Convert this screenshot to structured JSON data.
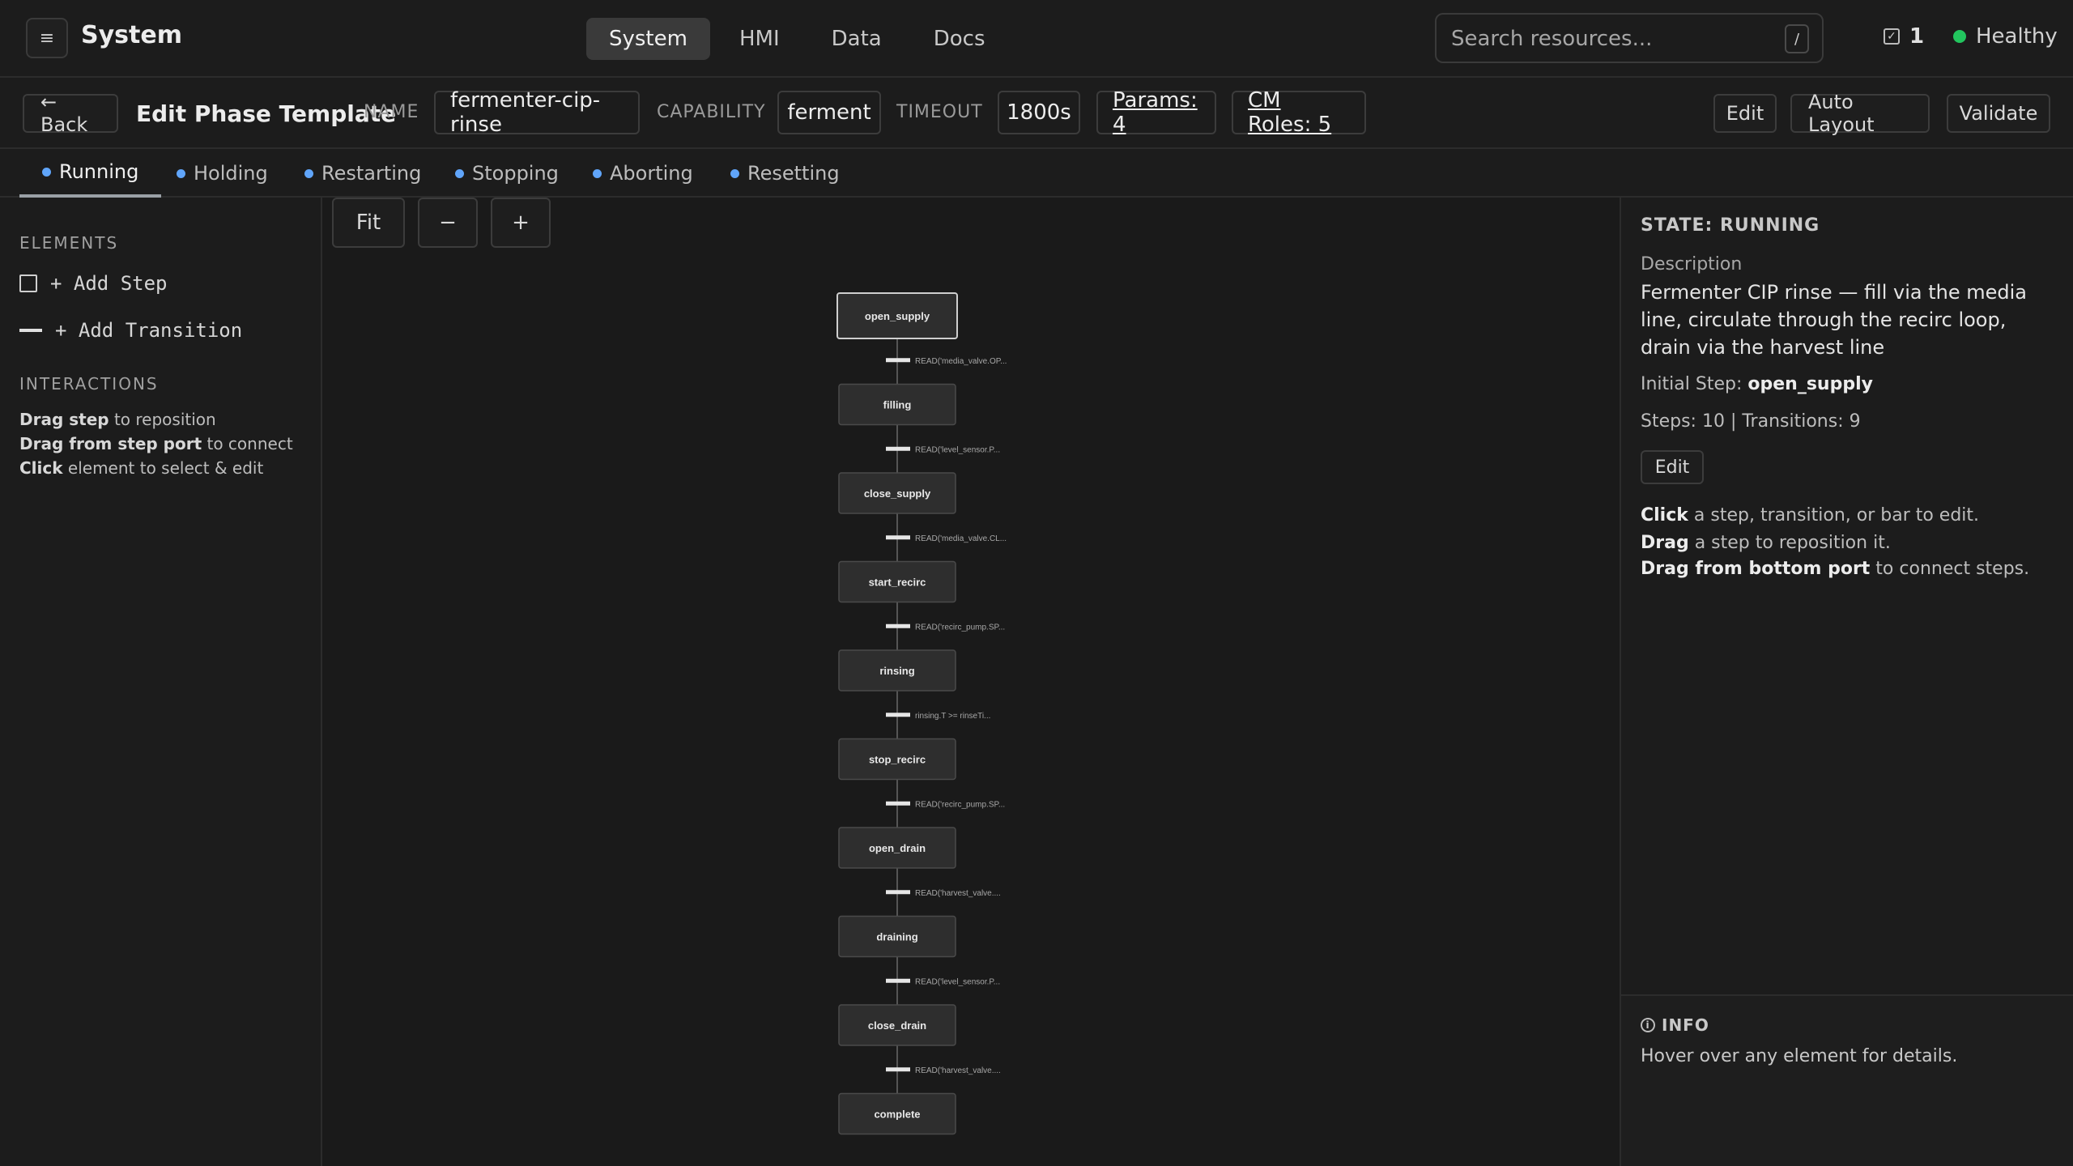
{
  "app": {
    "menu_glyph": "≡",
    "title": "System"
  },
  "nav": [
    {
      "label": "System",
      "active": true
    },
    {
      "label": "HMI",
      "active": false
    },
    {
      "label": "Data",
      "active": false
    },
    {
      "label": "Docs",
      "active": false
    }
  ],
  "search": {
    "placeholder": "Search resources...",
    "shortcut": "/"
  },
  "status": {
    "task_count": "1",
    "health": "Healthy",
    "health_color": "#22c55e"
  },
  "editbar": {
    "back": "← Back",
    "title": "Edit Phase Template",
    "name_label": "NAME",
    "name_value": "fermenter-cip-rinse",
    "capability_label": "CAPABILITY",
    "capability_value": "ferment",
    "timeout_label": "TIMEOUT",
    "timeout_value": "1800s",
    "params": "Params: 4",
    "cm_roles": "CM Roles: 5",
    "edit": "Edit",
    "auto_layout": "Auto Layout",
    "validate": "Validate"
  },
  "tabs": [
    {
      "label": "Running",
      "active": true
    },
    {
      "label": "Holding",
      "active": false
    },
    {
      "label": "Restarting",
      "active": false
    },
    {
      "label": "Stopping",
      "active": false
    },
    {
      "label": "Aborting",
      "active": false
    },
    {
      "label": "Resetting",
      "active": false
    }
  ],
  "left": {
    "elements_heading": "ELEMENTS",
    "add_step": "+ Add Step",
    "add_transition": "+ Add Transition",
    "interactions_heading": "INTERACTIONS",
    "help": [
      {
        "bold": "Drag step",
        "rest": " to reposition"
      },
      {
        "bold": "Drag from step port",
        "rest": " to connect"
      },
      {
        "bold": "Click",
        "rest": " element to select & edit"
      }
    ]
  },
  "canvas": {
    "fit": "Fit",
    "zoom_out": "−",
    "zoom_in": "+",
    "steps": [
      "open_supply",
      "filling",
      "close_supply",
      "start_recirc",
      "rinsing",
      "stop_recirc",
      "open_drain",
      "draining",
      "close_drain",
      "complete"
    ],
    "transitions": [
      "READ('media_valve.OP...",
      "READ('level_sensor.P...",
      "READ('media_valve.CL...",
      "READ('recirc_pump.SP...",
      "rinsing.T >= rinseTi...",
      "READ('recirc_pump.SP...",
      "READ('harvest_valve....",
      "READ('level_sensor.P...",
      "READ('harvest_valve...."
    ]
  },
  "right": {
    "heading": "STATE: RUNNING",
    "description_label": "Description",
    "description": "Fermenter CIP rinse — fill via the media line, circulate through the recirc loop, drain via the harvest line",
    "initial_label": "Initial Step:",
    "initial_value": "open_supply",
    "counts": "Steps: 10 | Transitions: 9",
    "edit": "Edit",
    "tips": [
      {
        "bold": "Click",
        "rest": " a step, transition, or bar to edit."
      },
      {
        "bold": "Drag",
        "rest": " a step to reposition it."
      },
      {
        "bold": "Drag from bottom port",
        "rest": " to connect steps."
      }
    ],
    "info_heading": "INFO",
    "info_text": "Hover over any element for details."
  }
}
